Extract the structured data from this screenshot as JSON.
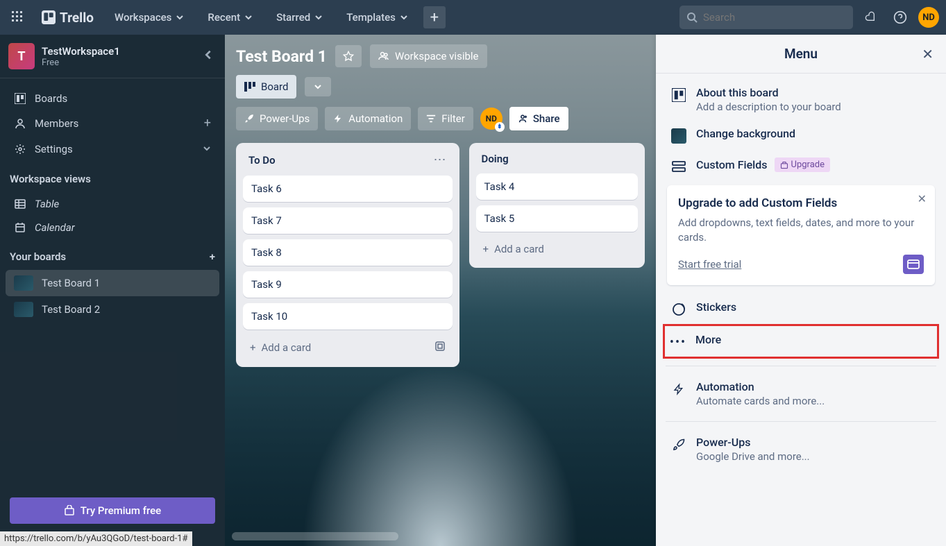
{
  "topnav": {
    "logo": "Trello",
    "workspaces": "Workspaces",
    "recent": "Recent",
    "starred": "Starred",
    "templates": "Templates",
    "search_placeholder": "Search",
    "avatar_initials": "ND"
  },
  "sidebar": {
    "workspace_initial": "T",
    "workspace_name": "TestWorkspace1",
    "workspace_plan": "Free",
    "boards": "Boards",
    "members": "Members",
    "settings": "Settings",
    "views_heading": "Workspace views",
    "table": "Table",
    "calendar": "Calendar",
    "your_boards_heading": "Your boards",
    "board1": "Test Board 1",
    "board2": "Test Board 2",
    "premium_btn": "Try Premium free",
    "status_url": "https://trello.com/b/yAu3QGoD/test-board-1#"
  },
  "board": {
    "title": "Test Board 1",
    "visibility": "Workspace visible",
    "view_label": "Board",
    "powerups": "Power-Ups",
    "automation": "Automation",
    "filter": "Filter",
    "share": "Share",
    "member_initials": "ND"
  },
  "lists": [
    {
      "title": "To Do",
      "cards": [
        "Task 6",
        "Task 7",
        "Task 8",
        "Task 9",
        "Task 10"
      ],
      "add": "Add a card"
    },
    {
      "title": "Doing",
      "cards": [
        "Task 4",
        "Task 5"
      ],
      "add": "Add a card"
    }
  ],
  "menu": {
    "title": "Menu",
    "about_title": "About this board",
    "about_sub": "Add a description to your board",
    "change_bg": "Change background",
    "custom_fields": "Custom Fields",
    "upgrade_pill": "Upgrade",
    "promo_title": "Upgrade to add Custom Fields",
    "promo_text": "Add dropdowns, text fields, dates, and more to your cards.",
    "promo_link": "Start free trial",
    "stickers": "Stickers",
    "more": "More",
    "automation_title": "Automation",
    "automation_sub": "Automate cards and more...",
    "powerups_title": "Power-Ups",
    "powerups_sub": "Google Drive and more..."
  }
}
